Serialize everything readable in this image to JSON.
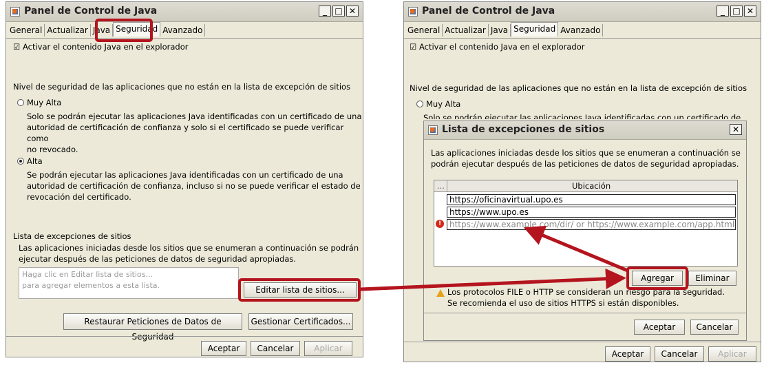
{
  "left_window": {
    "title": "Panel de Control de Java",
    "tabs": [
      "General",
      "Actualizar",
      "Java",
      "Seguridad",
      "Avanzado"
    ],
    "active_tab": "Seguridad",
    "checkbox_label": "Activar el contenido Java en el explorador",
    "security_heading": "Nivel de seguridad de las aplicaciones que no están en la lista de excepción de sitios",
    "option_very_high": "Muy Alta",
    "desc_very_high_1": "Solo se podrán ejecutar las aplicaciones Java identificadas con un certificado de una",
    "desc_very_high_2": "autoridad de certificación de confianza y solo si el certificado se puede verificar como",
    "desc_very_high_3": "no revocado.",
    "option_high": "Alta",
    "desc_high_1": "Se podrán ejecutar las aplicaciones Java identificadas con un certificado de una",
    "desc_high_2": "autoridad de certificación de confianza, incluso si no se puede verificar el estado de",
    "desc_high_3": "revocación del certificado.",
    "exceptions_heading": "Lista de excepciones de sitios",
    "exceptions_desc_1": "Las aplicaciones iniciadas desde los sitios que se enumeran a continuación se podrán",
    "exceptions_desc_2": "ejecutar después de las peticiones de datos de seguridad apropiadas.",
    "placeholder_1": "Haga clic en Editar lista de sitios...",
    "placeholder_2": "para agregar elementos a esta lista.",
    "edit_button": "Editar lista de sitios...",
    "restore_button": "Restaurar Peticiones de Datos de Seguridad",
    "manage_button": "Gestionar Certificados...",
    "ok": "Aceptar",
    "cancel": "Cancelar",
    "apply": "Aplicar"
  },
  "right_window": {
    "title": "Panel de Control de Java",
    "tabs": [
      "General",
      "Actualizar",
      "Java",
      "Seguridad",
      "Avanzado"
    ],
    "checkbox_label": "Activar el contenido Java en el explorador",
    "security_heading": "Nivel de seguridad de las aplicaciones que no están en la lista de excepción de sitios",
    "option_very_high": "Muy Alta",
    "partial_desc": "Solo se podrán ejecutar las aplicaciones Java identificadas con un certificado de una",
    "ok": "Aceptar",
    "cancel": "Cancelar",
    "apply": "Aplicar"
  },
  "dialog": {
    "title": "Lista de excepciones de sitios",
    "desc_1": "Las aplicaciones iniciadas desde los sitios que se enumeran a continuación se",
    "desc_2": "podrán ejecutar después de las peticiones de datos de seguridad apropiadas.",
    "col_dots": "...",
    "col_location": "Ubicación",
    "rows": [
      "https://oficinavirtual.upo.es",
      "https://www.upo.es",
      "https://www.example.com/dir/ or https://www.example.com/app.html"
    ],
    "add": "Agregar",
    "remove": "Eliminar",
    "warning_1": "Los protocolos FILE o HTTP se consideran un riesgo para la seguridad.",
    "warning_2": "Se recomienda el uso de sitios HTTPS si están disponibles.",
    "ok": "Aceptar",
    "cancel": "Cancelar"
  },
  "colors": {
    "highlight": "#b4141e",
    "window": "#ece9d8"
  }
}
